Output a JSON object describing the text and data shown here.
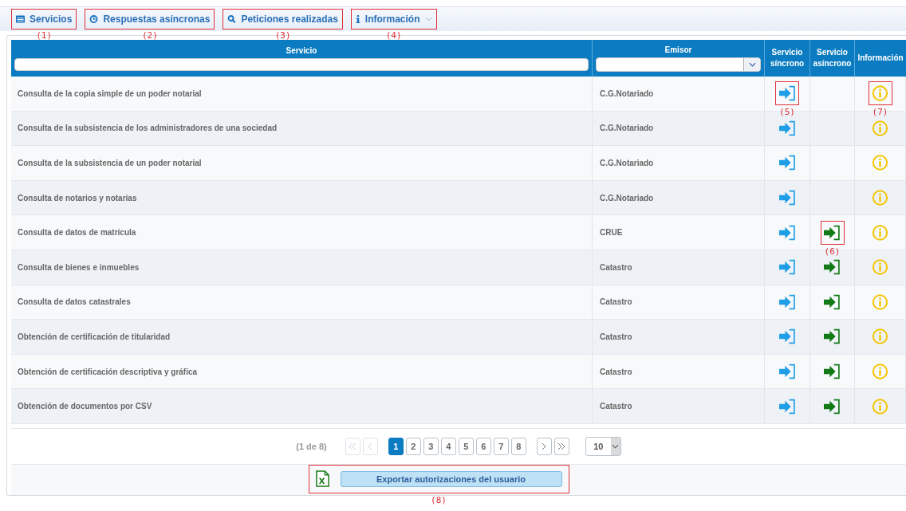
{
  "toolbar": [
    {
      "kind": "list",
      "label": "Servicios",
      "callout": "(1)",
      "dropdown": false
    },
    {
      "kind": "clock",
      "label": "Respuestas asíncronas",
      "callout": "(2)",
      "dropdown": false
    },
    {
      "kind": "search",
      "label": "Peticiones realizadas",
      "callout": "(3)",
      "dropdown": false
    },
    {
      "kind": "info",
      "label": "Información",
      "callout": "(4)",
      "dropdown": true
    }
  ],
  "table": {
    "columns": [
      {
        "kind": "text-filter",
        "label": "Servicio"
      },
      {
        "kind": "select-filter",
        "label": "Emisor"
      },
      {
        "kind": "plain",
        "label": "Servicio síncrono"
      },
      {
        "kind": "plain",
        "label": "Servicio asíncrono"
      },
      {
        "kind": "plain",
        "label": "Información"
      }
    ],
    "rows": [
      {
        "servicio": "Consulta de la copia simple de un poder notarial",
        "emisor": "C.G.Notariado",
        "sync": true,
        "async": false,
        "sync_callout": "(5)",
        "info_callout": "(7)"
      },
      {
        "servicio": "Consulta de la subsistencia de los administradores de una sociedad",
        "emisor": "C.G.Notariado",
        "sync": true,
        "async": false
      },
      {
        "servicio": "Consulta de la subsistencia de un poder notarial",
        "emisor": "C.G.Notariado",
        "sync": true,
        "async": false
      },
      {
        "servicio": "Consulta de notarios y notarías",
        "emisor": "C.G.Notariado",
        "sync": true,
        "async": false
      },
      {
        "servicio": "Consulta de datos de matrícula",
        "emisor": "CRUE",
        "sync": true,
        "async": true,
        "async_callout": "(6)"
      },
      {
        "servicio": "Consulta de bienes e inmuebles",
        "emisor": "Catastro",
        "sync": true,
        "async": true
      },
      {
        "servicio": "Consulta de datos catastrales",
        "emisor": "Catastro",
        "sync": true,
        "async": true
      },
      {
        "servicio": "Obtención de certificación de titularidad",
        "emisor": "Catastro",
        "sync": true,
        "async": true
      },
      {
        "servicio": "Obtención de certificación descriptiva y gráfica",
        "emisor": "Catastro",
        "sync": true,
        "async": true
      },
      {
        "servicio": "Obtención de documentos por CSV",
        "emisor": "Catastro",
        "sync": true,
        "async": true
      }
    ]
  },
  "pagination": {
    "summary": "(1 de 8)",
    "pages": [
      {
        "label": "1",
        "selected": true
      },
      {
        "label": "2",
        "selected": false
      },
      {
        "label": "3",
        "selected": false
      },
      {
        "label": "4",
        "selected": false
      },
      {
        "label": "5",
        "selected": false
      },
      {
        "label": "6",
        "selected": false
      },
      {
        "label": "7",
        "selected": false
      },
      {
        "label": "8",
        "selected": false
      }
    ],
    "first_disabled": true,
    "prev_disabled": true,
    "next_disabled": false,
    "last_disabled": false,
    "page_size": "10"
  },
  "export": {
    "label": "Exportar autorizaciones del usuario",
    "callout": "(8)"
  }
}
